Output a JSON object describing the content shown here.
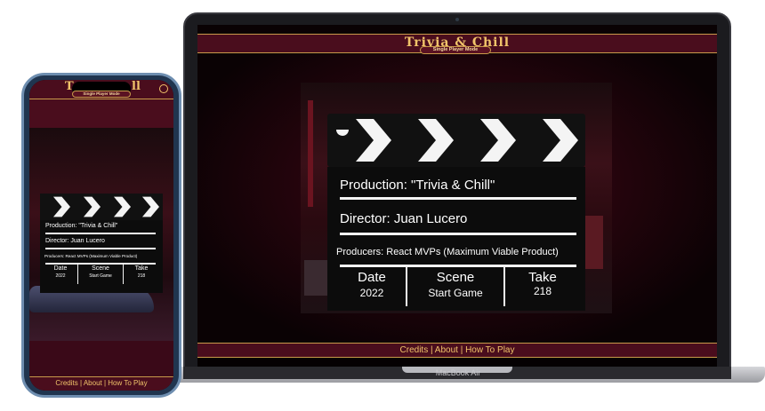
{
  "app": {
    "title": "Trivia & Chill",
    "mode_label": "Single Player Mode",
    "footer_links": "Credits | About | How To Play"
  },
  "device": {
    "laptop_label": "MacBook Air"
  },
  "clapperboard": {
    "production": "Production: \"Trivia & Chill\"",
    "director": "Director: Juan Lucero",
    "producers": "Producers: React MVPs (Maximum Viable Product)",
    "date_label": "Date",
    "date_value": "2022",
    "scene_label": "Scene",
    "scene_value": "Start Game",
    "take_label": "Take",
    "take_value": "218"
  },
  "phone": {
    "title_fragment_left": "T",
    "title_fragment_right": "ll",
    "mode_label": "Single Player Mode",
    "footer_links": "Credits | About | How To Play"
  },
  "colors": {
    "header_bg": "#4a0d1d",
    "accent_gold": "#f0c36a",
    "clapper_black": "#0c0c0c"
  }
}
